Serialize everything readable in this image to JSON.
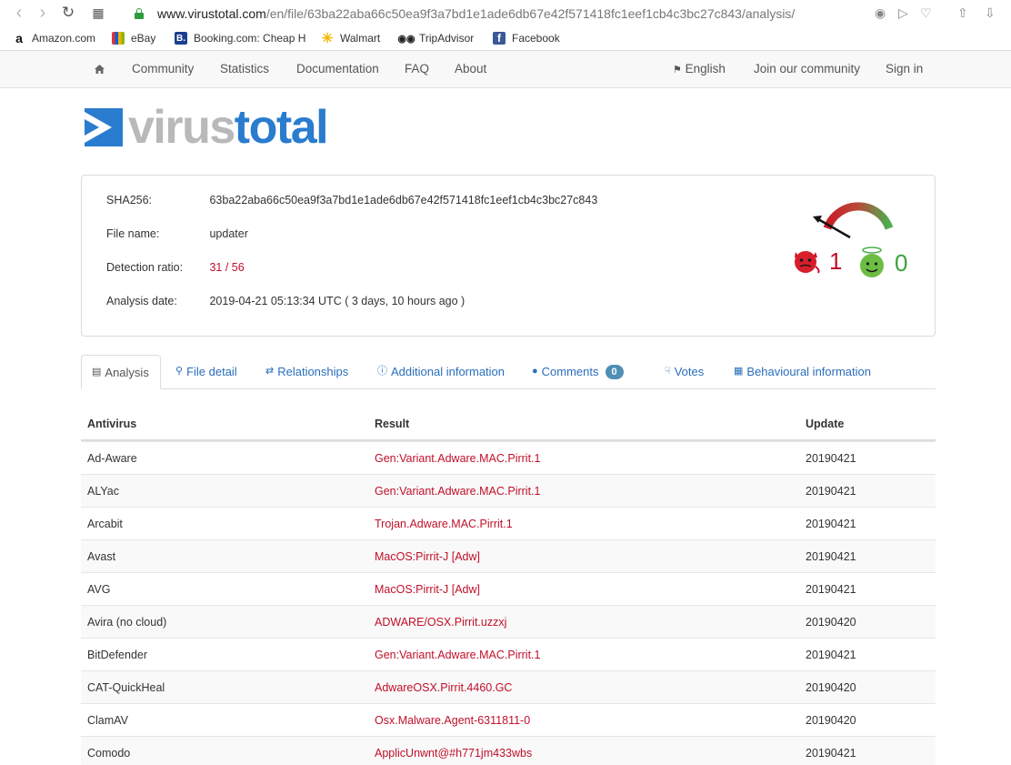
{
  "browser": {
    "url_domain": "www.virustotal.com",
    "url_path": "/en/file/63ba22aba66c50ea9f3a7bd1e1ade6db67e42f571418fc1eef1cb4c3bc27c843/analysis/",
    "bookmarks": [
      {
        "label": "Amazon.com",
        "icon": "amazon-icon"
      },
      {
        "label": "eBay",
        "icon": "ebay-icon"
      },
      {
        "label": "Booking.com: Cheap H",
        "icon": "booking-icon"
      },
      {
        "label": "Walmart",
        "icon": "walmart-icon"
      },
      {
        "label": "TripAdvisor",
        "icon": "tripadvisor-icon"
      },
      {
        "label": "Facebook",
        "icon": "facebook-icon"
      }
    ]
  },
  "nav": {
    "left": [
      "Community",
      "Statistics",
      "Documentation",
      "FAQ",
      "About"
    ],
    "language": "English",
    "join": "Join our community",
    "signin": "Sign in"
  },
  "logo": {
    "part1": "virus",
    "part2": "total"
  },
  "file": {
    "sha256_label": "SHA256:",
    "sha256": "63ba22aba66c50ea9f3a7bd1e1ade6db67e42f571418fc1eef1cb4c3bc27c843",
    "name_label": "File name:",
    "name": "updater",
    "ratio_label": "Detection ratio:",
    "ratio": "31 / 56",
    "date_label": "Analysis date:",
    "date": "2019-04-21 05:13:34 UTC ( 3 days, 10 hours ago )"
  },
  "votes": {
    "malicious": "1",
    "harmless": "0"
  },
  "tabs": [
    {
      "label": "Analysis",
      "icon": "list-icon"
    },
    {
      "label": "File detail",
      "icon": "search-icon"
    },
    {
      "label": "Relationships",
      "icon": "shuffle-icon"
    },
    {
      "label": "Additional information",
      "icon": "info-icon"
    },
    {
      "label": "Comments",
      "icon": "comment-icon",
      "badge": "0"
    },
    {
      "label": "Votes",
      "icon": "thumbs-down-icon"
    },
    {
      "label": "Behavioural information",
      "icon": "film-icon"
    }
  ],
  "table": {
    "headers": [
      "Antivirus",
      "Result",
      "Update"
    ],
    "rows": [
      [
        "Ad-Aware",
        "Gen:Variant.Adware.MAC.Pirrit.1",
        "20190421"
      ],
      [
        "ALYac",
        "Gen:Variant.Adware.MAC.Pirrit.1",
        "20190421"
      ],
      [
        "Arcabit",
        "Trojan.Adware.MAC.Pirrit.1",
        "20190421"
      ],
      [
        "Avast",
        "MacOS:Pirrit-J [Adw]",
        "20190421"
      ],
      [
        "AVG",
        "MacOS:Pirrit-J [Adw]",
        "20190421"
      ],
      [
        "Avira (no cloud)",
        "ADWARE/OSX.Pirrit.uzzxj",
        "20190420"
      ],
      [
        "BitDefender",
        "Gen:Variant.Adware.MAC.Pirrit.1",
        "20190421"
      ],
      [
        "CAT-QuickHeal",
        "AdwareOSX.Pirrit.4460.GC",
        "20190420"
      ],
      [
        "ClamAV",
        "Osx.Malware.Agent-6311811-0",
        "20190420"
      ],
      [
        "Comodo",
        "ApplicUnwnt@#h771jm433wbs",
        "20190421"
      ]
    ]
  },
  "colors": {
    "accent": "#2a7ccf",
    "malicious": "#c0102a",
    "harmless": "#3aa33a"
  }
}
